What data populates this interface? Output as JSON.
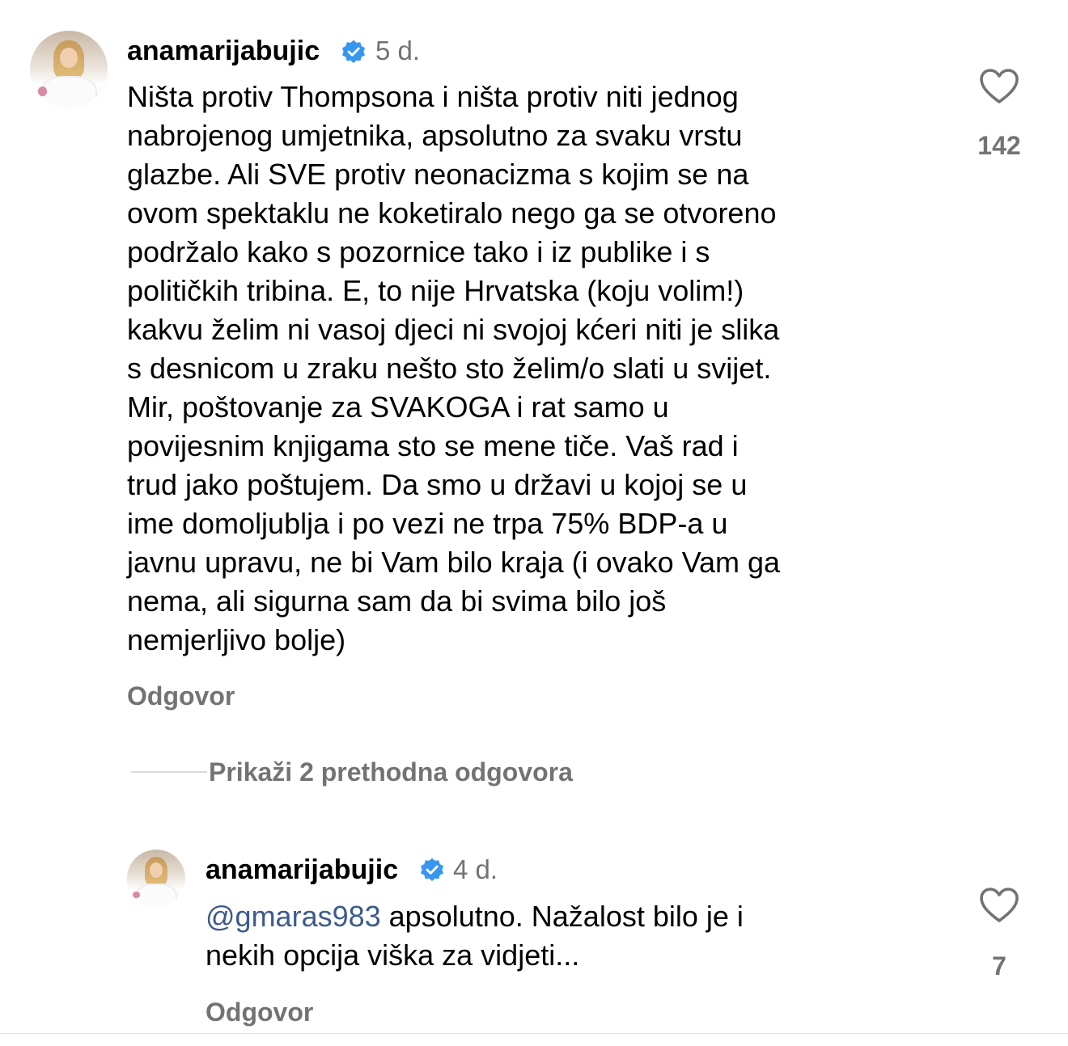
{
  "comment": {
    "username": "anamarijabujic",
    "time": "5 d.",
    "text": "Ništa protiv Thompsona i ništa protiv niti jednog\nnabrojenog umjetnika, apsolutno za svaku vrstu\nglazbe. Ali SVE protiv neonacizma s kojim se na\novom spektaklu ne koketiralo nego ga se otvoreno\npodržalo kako s pozornice tako i iz publike i s\npolitičkih tribina. E, to nije Hrvatska (koju volim!)\nkakvu želim ni vasoj djeci ni svojoj kćeri niti je slika\ns desnicom u zraku nešto sto želim/o slati u svijet.\nMir, poštovanje za SVAKOGA i rat samo u\npovijesnim knjigama sto se mene tiče. Vaš rad i\ntrud jako poštujem. Da smo u državi u kojoj se u\nime domoljublja i po vezi ne trpa 75% BDP-a u\njavnu upravu, ne bi Vam bilo kraja (i ovako Vam ga\nnema, ali sigurna sam da bi svima bilo još\nnemjerljivo bolje)",
    "likes": "142",
    "reply_label": "Odgovor"
  },
  "thread": {
    "show_replies_label": "Prikaži 2 prethodna odgovora"
  },
  "reply": {
    "username": "anamarijabujic",
    "time": "4 d.",
    "mention": "@gmaras983",
    "text_line1": " apsolutno. Nažalost bilo je i",
    "text_line2": "nekih opcija viška za vidjeti...",
    "likes": "7",
    "reply_label": "Odgovor"
  },
  "colors": {
    "verified": "#3797f0",
    "secondary_text": "#737373",
    "mention": "#3d5a8c"
  },
  "icons": {
    "verified": "verified-badge-icon",
    "like": "heart-outline-icon"
  }
}
